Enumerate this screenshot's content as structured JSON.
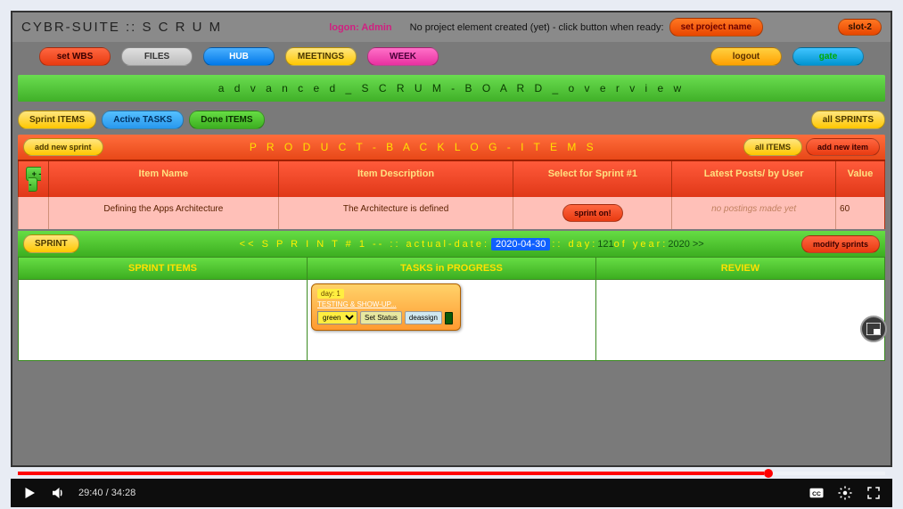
{
  "app": {
    "title": "CYBR-SUITE :: S C R U M",
    "login_label": "logon: Admin",
    "header_message": "No project element created (yet) - click button when ready:",
    "set_project_btn": "set project name",
    "slot_btn": "slot-2"
  },
  "topnav": {
    "set_wbs": "set WBS",
    "files": "FILES",
    "hub": "HUB",
    "meetings": "MEETINGS",
    "week": "WEEK",
    "logout": "logout",
    "gate": "gate"
  },
  "board_title": "a d v a n c e d _ S C R U M - B O A R D _ o v e r v i e w",
  "tabs": {
    "sprint_items": "Sprint ITEMS",
    "active_tasks": "Active TASKS",
    "done_items": "Done ITEMS",
    "all_sprints": "all SPRINTS"
  },
  "backlog": {
    "add_sprint": "add new sprint",
    "title": "P R O D U C T - B A C K L O G - I T E M S",
    "all_items": "all ITEMS",
    "add_item": "add new item",
    "headers": {
      "toggle": "+ --",
      "name": "Item Name",
      "desc": "Item Description",
      "select": "Select for Sprint #1",
      "posts": "Latest Posts/ by User",
      "value": "Value"
    },
    "row": {
      "name": "Defining the Apps Architecture",
      "desc": "The Architecture is defined",
      "sprint_btn": "sprint on!",
      "posts": "no postings made yet",
      "value": "60"
    }
  },
  "sprint": {
    "btn": "SPRINT",
    "prefix": "<< S P R I N T # 1 -- :: actual-date:",
    "date": "2020-04-30",
    "day_label": ":: day:",
    "day": "121",
    "of_year": "of year:",
    "year": "2020 >>",
    "modify": "modify sprints"
  },
  "board": {
    "col1": "SPRINT ITEMS",
    "col2": "TASKS in PROGRESS",
    "col3": "REVIEW"
  },
  "task": {
    "day_badge": "day: 1",
    "title": "TESTING & SHOW-UP...",
    "status_option": "green",
    "set_status": "Set Status",
    "deassign": "deassign"
  },
  "video": {
    "current": "29:40",
    "duration": "34:28",
    "progress_pct": 86
  }
}
